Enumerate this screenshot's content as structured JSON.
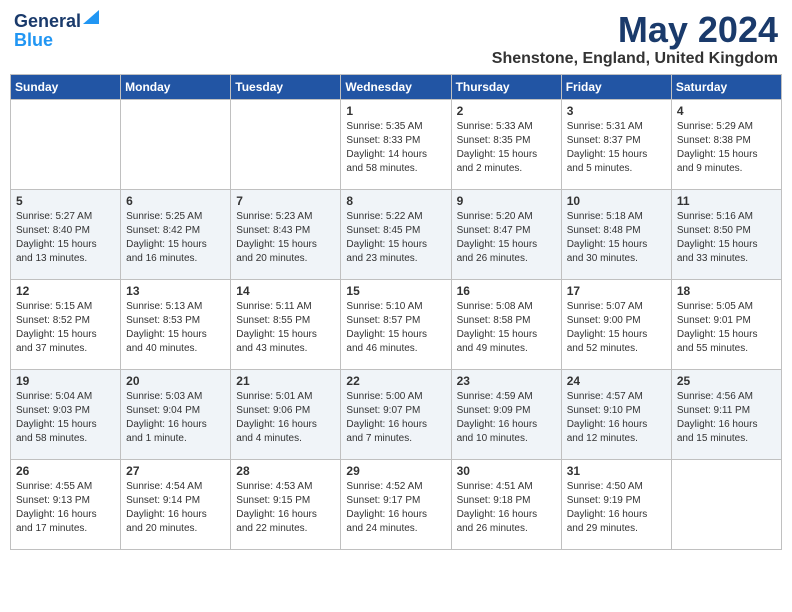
{
  "header": {
    "logo_general": "General",
    "logo_blue": "Blue",
    "month_title": "May 2024",
    "location": "Shenstone, England, United Kingdom"
  },
  "days_of_week": [
    "Sunday",
    "Monday",
    "Tuesday",
    "Wednesday",
    "Thursday",
    "Friday",
    "Saturday"
  ],
  "weeks": [
    [
      {
        "day": "",
        "info": ""
      },
      {
        "day": "",
        "info": ""
      },
      {
        "day": "",
        "info": ""
      },
      {
        "day": "1",
        "info": "Sunrise: 5:35 AM\nSunset: 8:33 PM\nDaylight: 14 hours\nand 58 minutes."
      },
      {
        "day": "2",
        "info": "Sunrise: 5:33 AM\nSunset: 8:35 PM\nDaylight: 15 hours\nand 2 minutes."
      },
      {
        "day": "3",
        "info": "Sunrise: 5:31 AM\nSunset: 8:37 PM\nDaylight: 15 hours\nand 5 minutes."
      },
      {
        "day": "4",
        "info": "Sunrise: 5:29 AM\nSunset: 8:38 PM\nDaylight: 15 hours\nand 9 minutes."
      }
    ],
    [
      {
        "day": "5",
        "info": "Sunrise: 5:27 AM\nSunset: 8:40 PM\nDaylight: 15 hours\nand 13 minutes."
      },
      {
        "day": "6",
        "info": "Sunrise: 5:25 AM\nSunset: 8:42 PM\nDaylight: 15 hours\nand 16 minutes."
      },
      {
        "day": "7",
        "info": "Sunrise: 5:23 AM\nSunset: 8:43 PM\nDaylight: 15 hours\nand 20 minutes."
      },
      {
        "day": "8",
        "info": "Sunrise: 5:22 AM\nSunset: 8:45 PM\nDaylight: 15 hours\nand 23 minutes."
      },
      {
        "day": "9",
        "info": "Sunrise: 5:20 AM\nSunset: 8:47 PM\nDaylight: 15 hours\nand 26 minutes."
      },
      {
        "day": "10",
        "info": "Sunrise: 5:18 AM\nSunset: 8:48 PM\nDaylight: 15 hours\nand 30 minutes."
      },
      {
        "day": "11",
        "info": "Sunrise: 5:16 AM\nSunset: 8:50 PM\nDaylight: 15 hours\nand 33 minutes."
      }
    ],
    [
      {
        "day": "12",
        "info": "Sunrise: 5:15 AM\nSunset: 8:52 PM\nDaylight: 15 hours\nand 37 minutes."
      },
      {
        "day": "13",
        "info": "Sunrise: 5:13 AM\nSunset: 8:53 PM\nDaylight: 15 hours\nand 40 minutes."
      },
      {
        "day": "14",
        "info": "Sunrise: 5:11 AM\nSunset: 8:55 PM\nDaylight: 15 hours\nand 43 minutes."
      },
      {
        "day": "15",
        "info": "Sunrise: 5:10 AM\nSunset: 8:57 PM\nDaylight: 15 hours\nand 46 minutes."
      },
      {
        "day": "16",
        "info": "Sunrise: 5:08 AM\nSunset: 8:58 PM\nDaylight: 15 hours\nand 49 minutes."
      },
      {
        "day": "17",
        "info": "Sunrise: 5:07 AM\nSunset: 9:00 PM\nDaylight: 15 hours\nand 52 minutes."
      },
      {
        "day": "18",
        "info": "Sunrise: 5:05 AM\nSunset: 9:01 PM\nDaylight: 15 hours\nand 55 minutes."
      }
    ],
    [
      {
        "day": "19",
        "info": "Sunrise: 5:04 AM\nSunset: 9:03 PM\nDaylight: 15 hours\nand 58 minutes."
      },
      {
        "day": "20",
        "info": "Sunrise: 5:03 AM\nSunset: 9:04 PM\nDaylight: 16 hours\nand 1 minute."
      },
      {
        "day": "21",
        "info": "Sunrise: 5:01 AM\nSunset: 9:06 PM\nDaylight: 16 hours\nand 4 minutes."
      },
      {
        "day": "22",
        "info": "Sunrise: 5:00 AM\nSunset: 9:07 PM\nDaylight: 16 hours\nand 7 minutes."
      },
      {
        "day": "23",
        "info": "Sunrise: 4:59 AM\nSunset: 9:09 PM\nDaylight: 16 hours\nand 10 minutes."
      },
      {
        "day": "24",
        "info": "Sunrise: 4:57 AM\nSunset: 9:10 PM\nDaylight: 16 hours\nand 12 minutes."
      },
      {
        "day": "25",
        "info": "Sunrise: 4:56 AM\nSunset: 9:11 PM\nDaylight: 16 hours\nand 15 minutes."
      }
    ],
    [
      {
        "day": "26",
        "info": "Sunrise: 4:55 AM\nSunset: 9:13 PM\nDaylight: 16 hours\nand 17 minutes."
      },
      {
        "day": "27",
        "info": "Sunrise: 4:54 AM\nSunset: 9:14 PM\nDaylight: 16 hours\nand 20 minutes."
      },
      {
        "day": "28",
        "info": "Sunrise: 4:53 AM\nSunset: 9:15 PM\nDaylight: 16 hours\nand 22 minutes."
      },
      {
        "day": "29",
        "info": "Sunrise: 4:52 AM\nSunset: 9:17 PM\nDaylight: 16 hours\nand 24 minutes."
      },
      {
        "day": "30",
        "info": "Sunrise: 4:51 AM\nSunset: 9:18 PM\nDaylight: 16 hours\nand 26 minutes."
      },
      {
        "day": "31",
        "info": "Sunrise: 4:50 AM\nSunset: 9:19 PM\nDaylight: 16 hours\nand 29 minutes."
      },
      {
        "day": "",
        "info": ""
      }
    ]
  ]
}
